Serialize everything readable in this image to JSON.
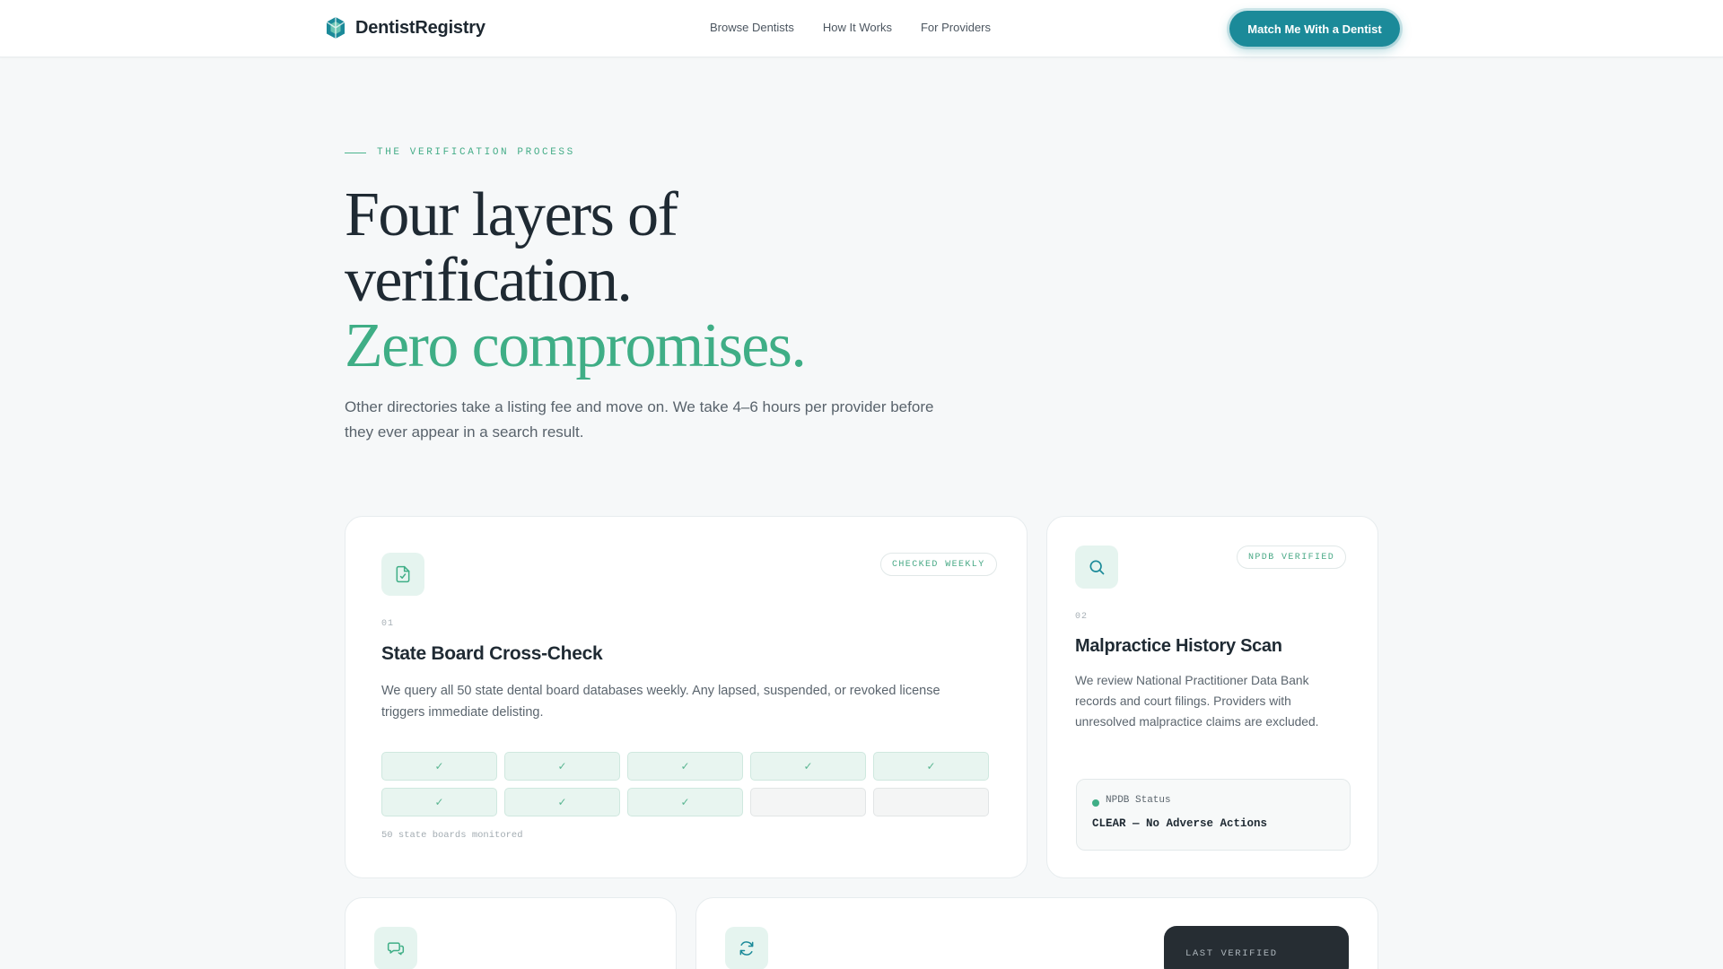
{
  "nav": {
    "brand": "DentistRegistry",
    "links": [
      "Browse Dentists",
      "How It Works",
      "For Providers"
    ],
    "cta": "Match Me With a Dentist"
  },
  "hero": {
    "eyebrow": "THE VERIFICATION PROCESS",
    "title_line1": "Four layers of",
    "title_line2": "verification.",
    "title_accent": "Zero compromises.",
    "lead": "Other directories take a listing fee and move on. We take 4–6 hours per provider before they ever appear in a search result."
  },
  "cards": {
    "state_board": {
      "tag": "CHECKED WEEKLY",
      "number": "01",
      "title": "State Board Cross-Check",
      "description": "We query all 50 state dental board databases weekly. Any lapsed, suspended, or revoked license triggers immediate delisting.",
      "check_mark": "✓",
      "grid_checked": [
        true,
        true,
        true,
        true,
        true,
        true,
        true,
        true,
        false,
        false
      ],
      "caption": "50 state boards monitored"
    },
    "malpractice": {
      "tag": "NPDB VERIFIED",
      "number": "02",
      "title": "Malpractice History Scan",
      "description": "We review National Practitioner Data Bank records and court filings. Providers with unresolved malpractice claims are excluded.",
      "status_label": "NPDB Status",
      "status_value": "CLEAR — No Adverse Actions"
    },
    "card3": {
      "icon": "chat-icon"
    },
    "card4": {
      "icon": "refresh-icon",
      "panel_label": "LAST VERIFIED"
    }
  },
  "colors": {
    "accent_green": "#3fae86",
    "cta_teal": "#1b8a99",
    "icon_bg": "#e5f4ef"
  }
}
